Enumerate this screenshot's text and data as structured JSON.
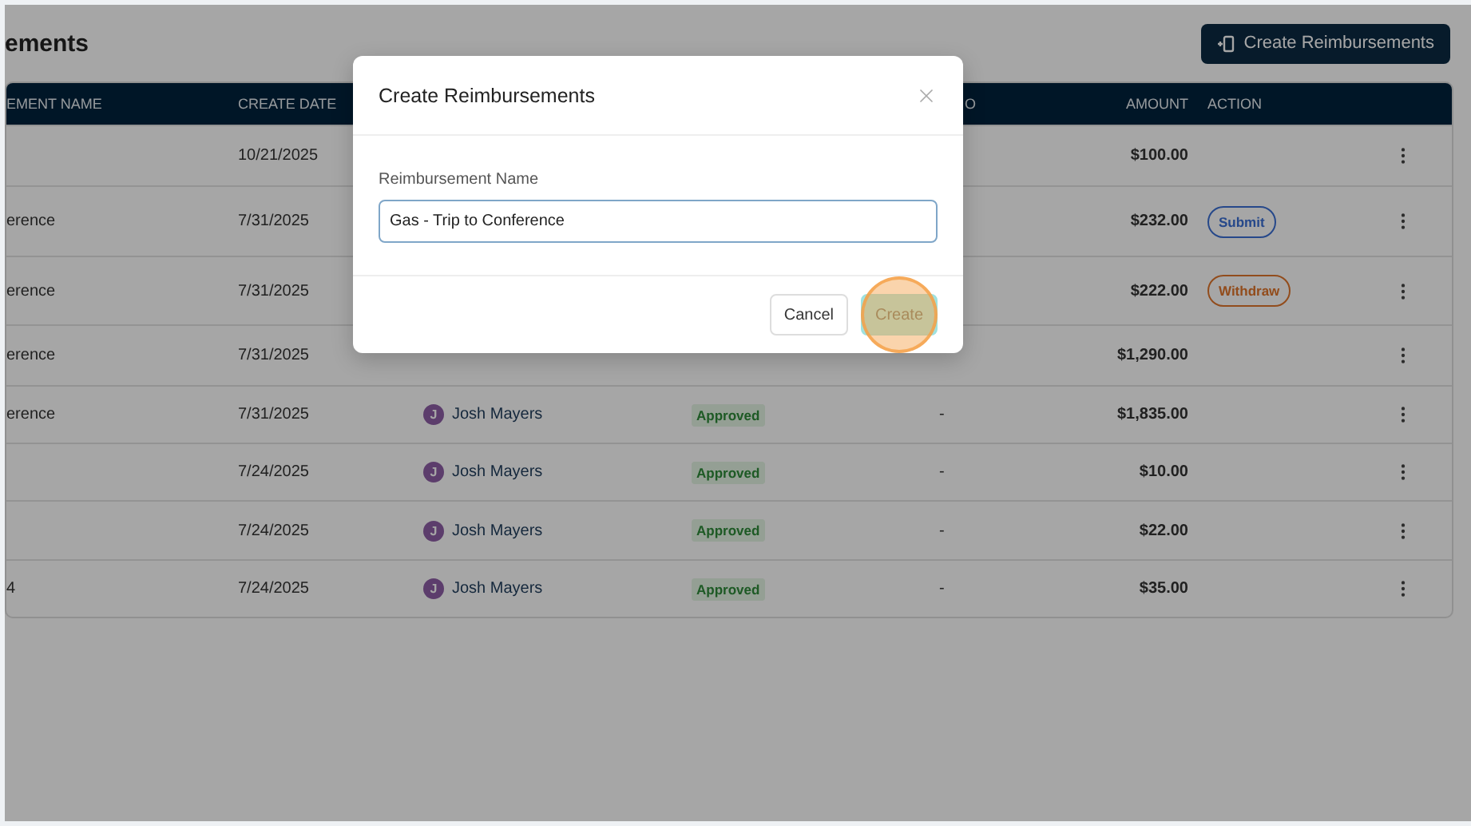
{
  "page": {
    "title": "ements",
    "create_button": "Create Reimbursements"
  },
  "table": {
    "columns": {
      "name": "EMENT NAME",
      "create_date": "CREATE DATE",
      "column_5": "O",
      "amount": "AMOUNT",
      "action": "ACTION"
    },
    "rows": [
      {
        "create_date": "10/21/2025",
        "amount": "$100.00"
      },
      {
        "name": "erence",
        "create_date": "7/31/2025",
        "amount": "$232.00",
        "action": {
          "kind": "submit",
          "label": "Submit"
        }
      },
      {
        "name": "erence",
        "create_date": "7/31/2025",
        "amount": "$222.00",
        "action": {
          "kind": "withdraw",
          "label": "Withdraw"
        }
      },
      {
        "name": "erence",
        "create_date": "7/31/2025",
        "amount": "$1,290.00"
      },
      {
        "name": "erence",
        "create_date": "7/31/2025",
        "avatar": "J",
        "employee": "Josh Mayers",
        "status": "Approved",
        "column_5": "-",
        "amount": "$1,835.00"
      },
      {
        "create_date": "7/24/2025",
        "avatar": "J",
        "employee": "Josh Mayers",
        "status": "Approved",
        "column_5": "-",
        "amount": "$10.00"
      },
      {
        "create_date": "7/24/2025",
        "avatar": "J",
        "employee": "Josh Mayers",
        "status": "Approved",
        "column_5": "-",
        "amount": "$22.00"
      },
      {
        "name": "4",
        "create_date": "7/24/2025",
        "avatar": "J",
        "employee": "Josh Mayers",
        "status": "Approved",
        "column_5": "-",
        "amount": "$35.00"
      }
    ]
  },
  "modal": {
    "title": "Create Reimbursements",
    "field_label": "Reimbursement Name",
    "field_value": "Gas - Trip to Conference",
    "buttons": [
      {
        "label": "Cancel",
        "kind": "secondary"
      },
      {
        "label": "Create",
        "kind": "primary"
      }
    ]
  }
}
